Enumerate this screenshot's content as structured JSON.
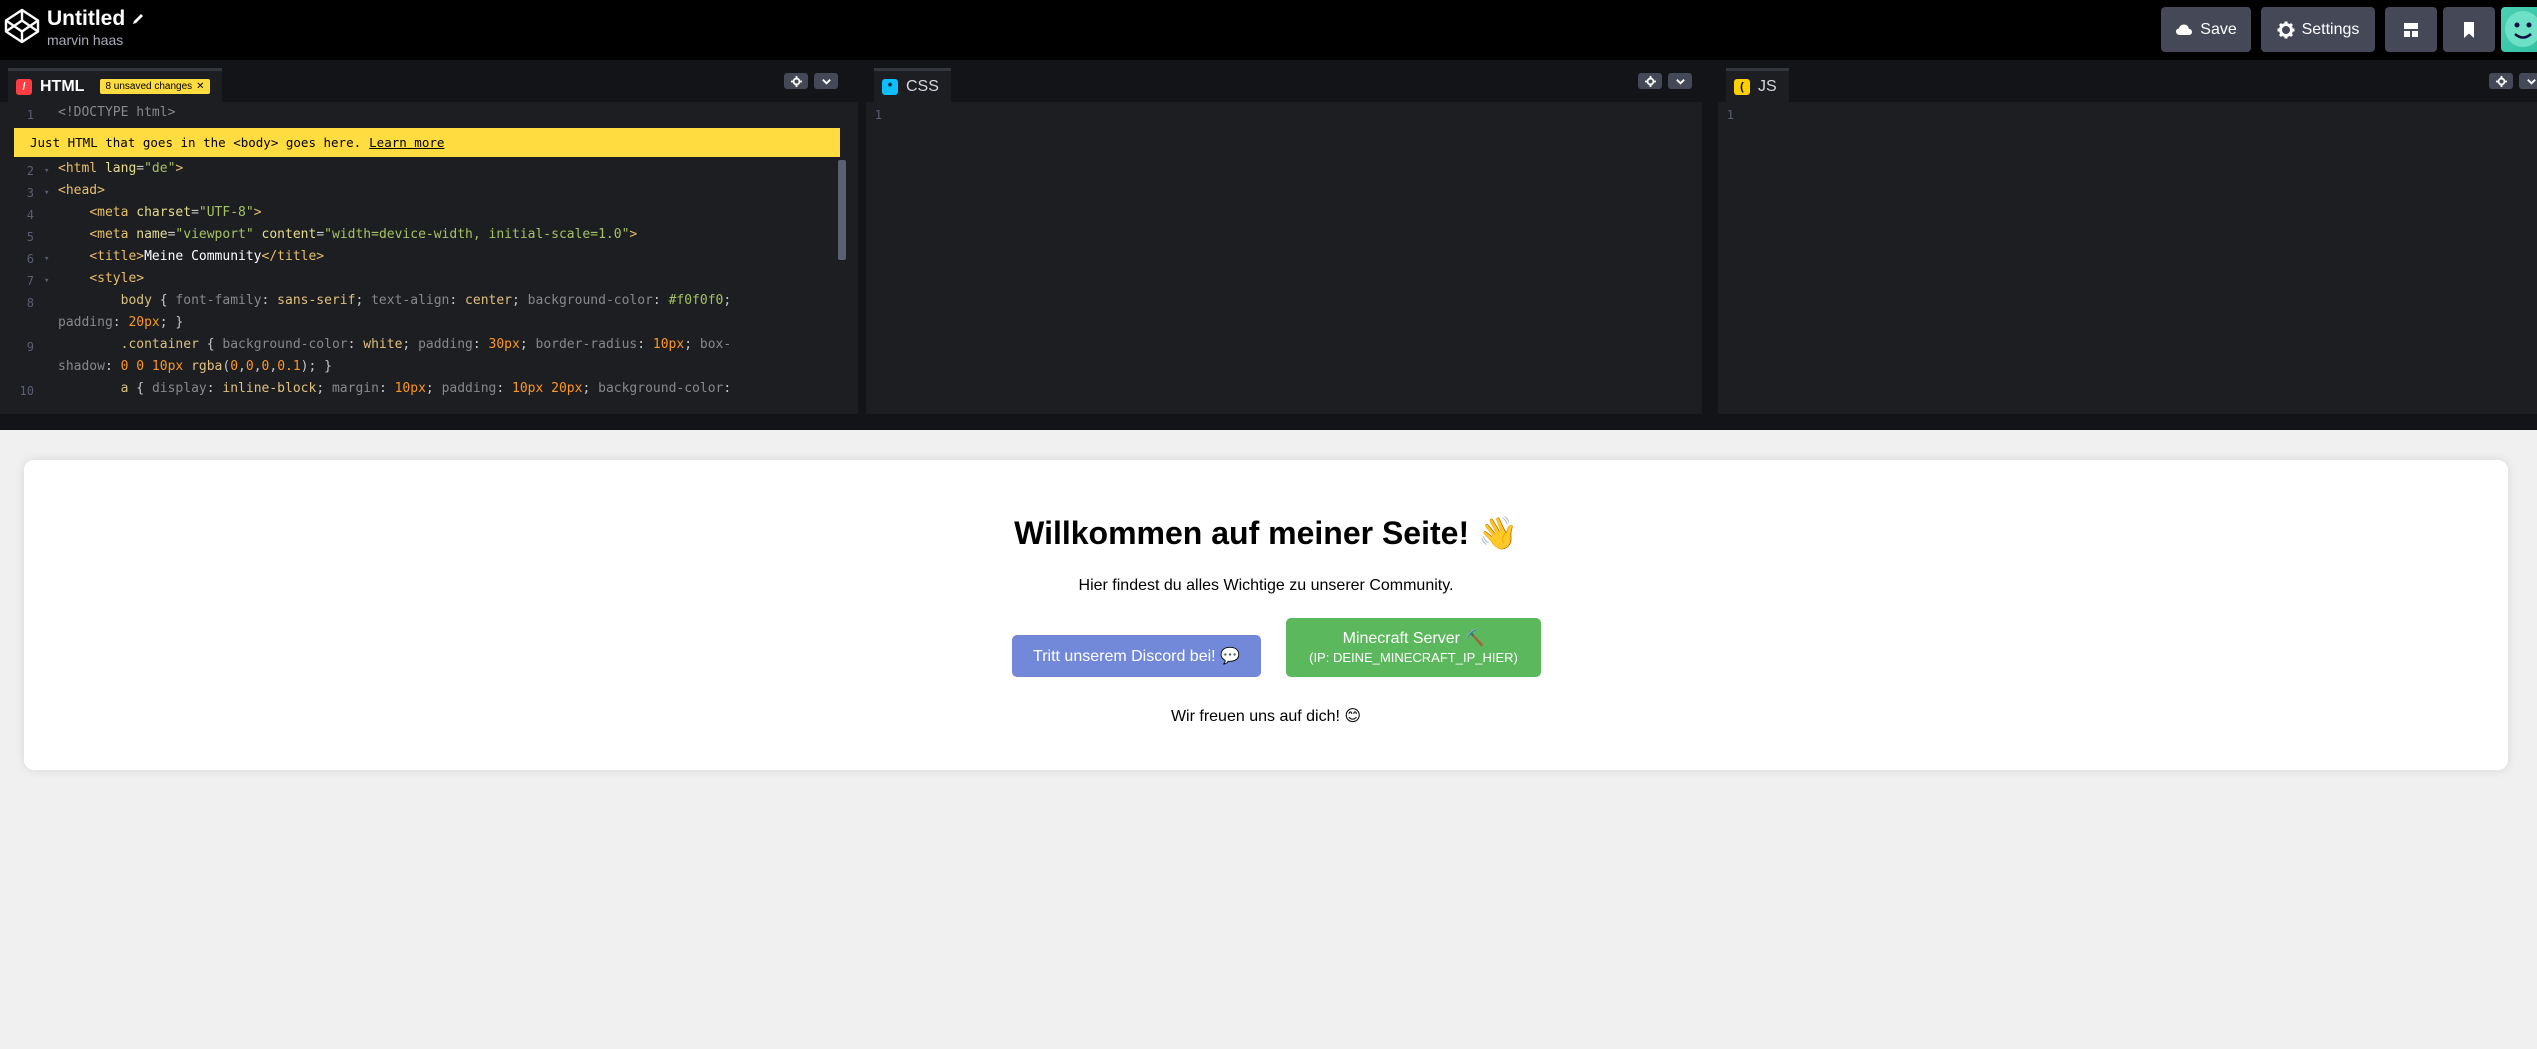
{
  "topbar": {
    "title": "Untitled",
    "user": "marvin haas",
    "save_label": "Save",
    "settings_label": "Settings"
  },
  "panes": {
    "html": {
      "label": "HTML",
      "badge": "8 unsaved changes",
      "icon": "html-icon"
    },
    "css": {
      "label": "CSS",
      "icon": "css-icon"
    },
    "js": {
      "label": "JS",
      "icon": "js-icon"
    }
  },
  "tip": {
    "text": "Just HTML that goes in the <body> goes here.",
    "link": "Learn more"
  },
  "code_lines": [
    "1",
    "2",
    "3",
    "4",
    "5",
    "6",
    "7",
    "8",
    "9",
    "10"
  ],
  "empty_line": "1",
  "preview": {
    "heading": "Willkommen auf meiner Seite! 👋",
    "sub": "Hier findest du alles Wichtige zu unserer Community.",
    "discord_button": "Tritt unserem Discord bei! 💬",
    "mc_button_line1": "Minecraft Server ⛏️",
    "mc_button_line2": "(IP: DEINE_MINECRAFT_IP_HIER)",
    "footer": "Wir freuen uns auf dich! 😊"
  },
  "colors": {
    "topbar": "#000000",
    "editor_bg": "#1d1e22",
    "tip": "#ffdd40",
    "discord": "#7289da",
    "minecraft": "#5cb85c"
  }
}
